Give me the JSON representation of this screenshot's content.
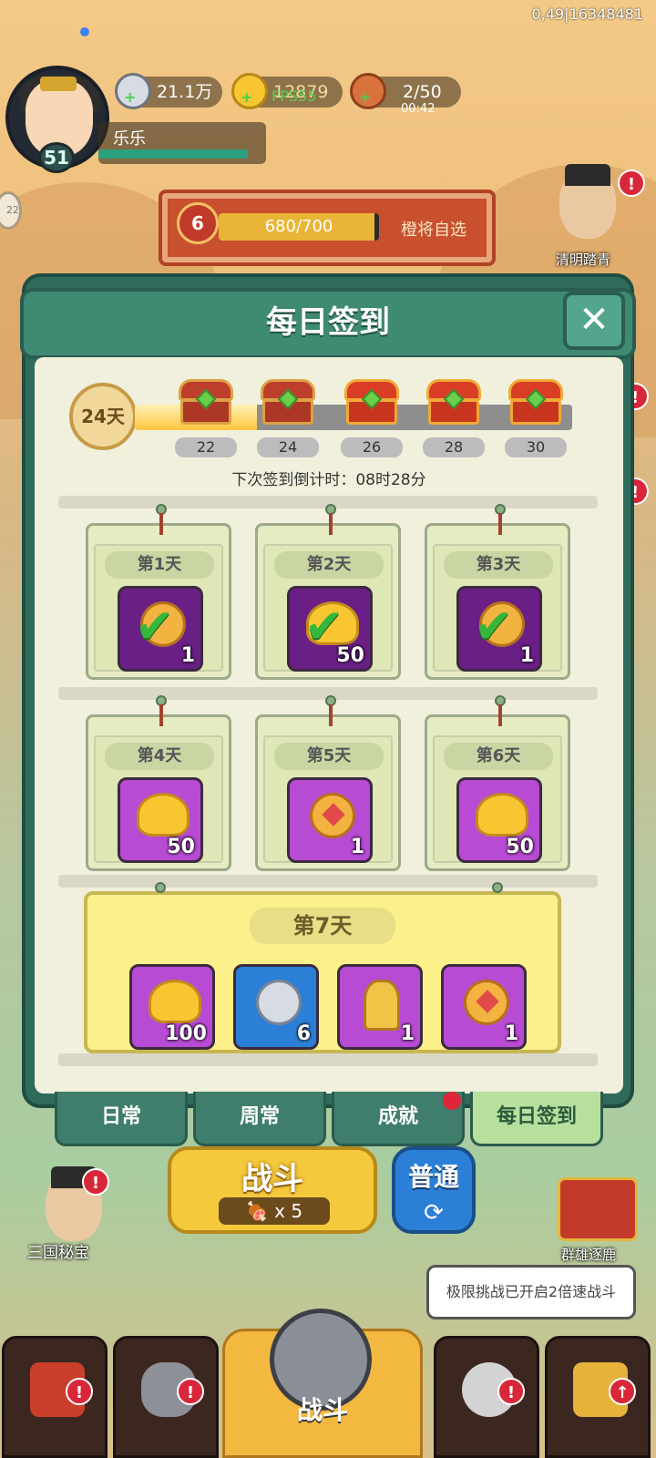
{
  "hud": {
    "debug_text": "0,49|16348481",
    "player": {
      "name": "乐乐",
      "level": "51"
    },
    "resources": [
      {
        "name": "silver-coin-icon",
        "value": "21.1万"
      },
      {
        "name": "gold-ingot-icon",
        "value": "12879"
      },
      {
        "name": "meat-icon",
        "value": "2/50"
      }
    ],
    "fps": "FPS55",
    "stamina_timer": "00:42",
    "rank": {
      "level": "6",
      "progress": "680/700",
      "fraction": 0.971,
      "pick_label": "橙将自选"
    },
    "npc_right_label": "清明踏青",
    "side_badge": "22"
  },
  "dialog": {
    "title": "每日签到",
    "close_icon": "close-icon",
    "days_signed": "24天",
    "progress_fraction": 0.28,
    "milestones": [
      "22",
      "24",
      "26",
      "28",
      "30"
    ],
    "countdown": "下次签到倒计时：08时28分",
    "days": [
      {
        "label": "第1天",
        "qty": "1",
        "claimed": true,
        "item": "coin-icon"
      },
      {
        "label": "第2天",
        "qty": "50",
        "claimed": true,
        "item": "gold-ingot-icon"
      },
      {
        "label": "第3天",
        "qty": "1",
        "claimed": true,
        "item": "coin-icon"
      },
      {
        "label": "第4天",
        "qty": "50",
        "claimed": false,
        "item": "gold-ingot-icon"
      },
      {
        "label": "第5天",
        "qty": "1",
        "claimed": false,
        "item": "heart-coin-icon"
      },
      {
        "label": "第6天",
        "qty": "50",
        "claimed": false,
        "item": "gold-ingot-icon"
      }
    ],
    "day7": {
      "label": "第7天",
      "rewards": [
        {
          "item": "gold-ingot-icon",
          "qty": "100"
        },
        {
          "item": "silver-coin-icon",
          "qty": "6"
        },
        {
          "item": "golden-key-icon",
          "qty": "1"
        },
        {
          "item": "heart-coin-icon",
          "qty": "1"
        }
      ]
    }
  },
  "tabs": [
    "日常",
    "周常",
    "成就",
    "每日签到"
  ],
  "battle": {
    "label": "战斗",
    "cost": "x 5",
    "mode": "普通",
    "left_npc_label": "三国秘宝",
    "right_label": "群雄逐鹿",
    "tip": "极限挑战已开启2倍速战斗"
  },
  "nav": {
    "center_label": "战斗"
  },
  "colors": {
    "accent_green": "#3e8a73",
    "alert_red": "#d9273a",
    "gold": "#f5c93c"
  }
}
